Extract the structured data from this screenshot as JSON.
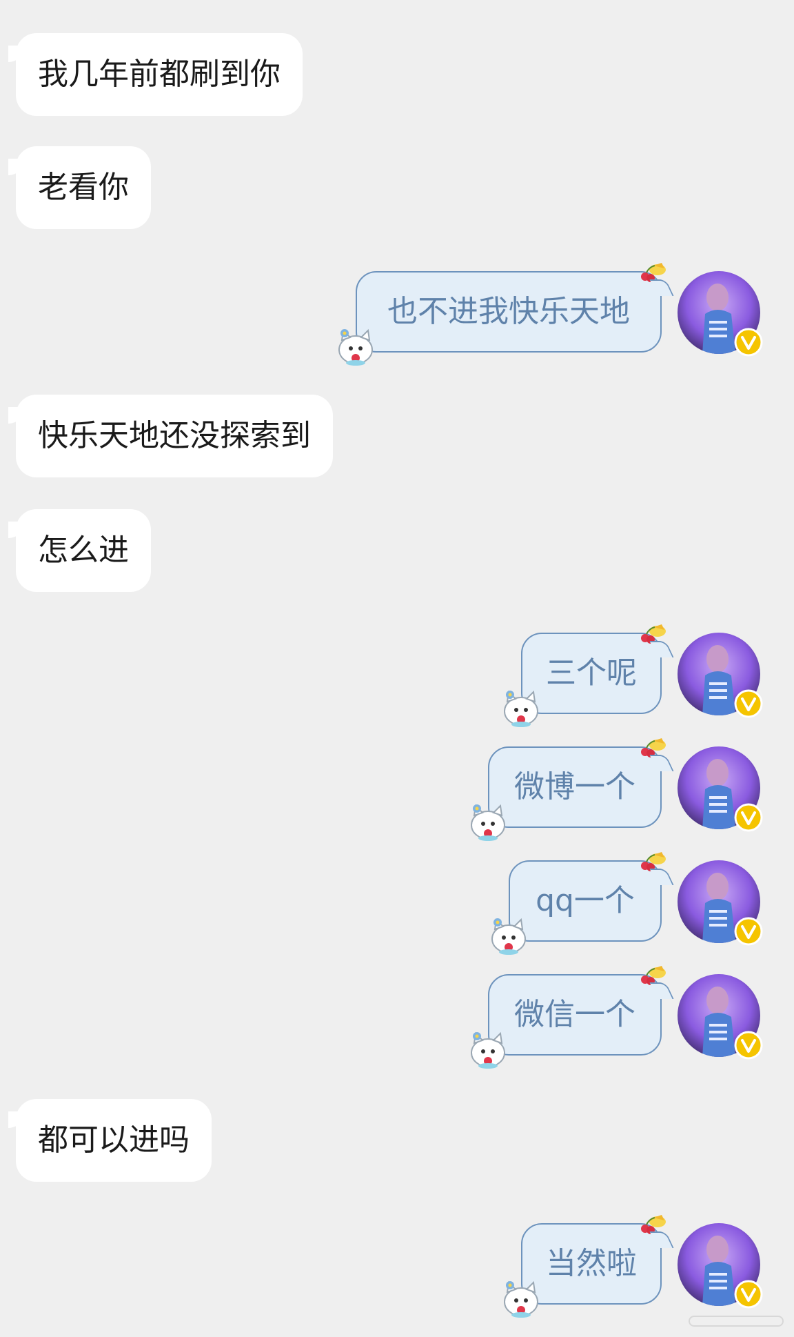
{
  "messages": [
    {
      "side": "left",
      "text": "我几年前都刷到你"
    },
    {
      "side": "left",
      "text": "老看你"
    },
    {
      "side": "right",
      "text": "也不进我快乐天地"
    },
    {
      "side": "left",
      "text": "快乐天地还没探索到"
    },
    {
      "side": "left",
      "text": "怎么进"
    },
    {
      "side": "right",
      "text": "三个呢"
    },
    {
      "side": "right",
      "text": "微博一个"
    },
    {
      "side": "right",
      "text": "qq一个"
    },
    {
      "side": "right",
      "text": "微信一个"
    },
    {
      "side": "left",
      "text": "都可以进吗"
    },
    {
      "side": "right",
      "text": "当然啦"
    }
  ],
  "colors": {
    "background": "#efefef",
    "left_bubble": "#ffffff",
    "right_bubble": "#e3eef8",
    "right_border": "#6d93bd",
    "right_text": "#5f82aa",
    "badge": "#f5c400"
  },
  "icons": {
    "avatar": "user-avatar",
    "badge": "vip-badge-icon",
    "cat": "cat-sticker-icon",
    "fruit": "fruit-decoration-icon"
  }
}
